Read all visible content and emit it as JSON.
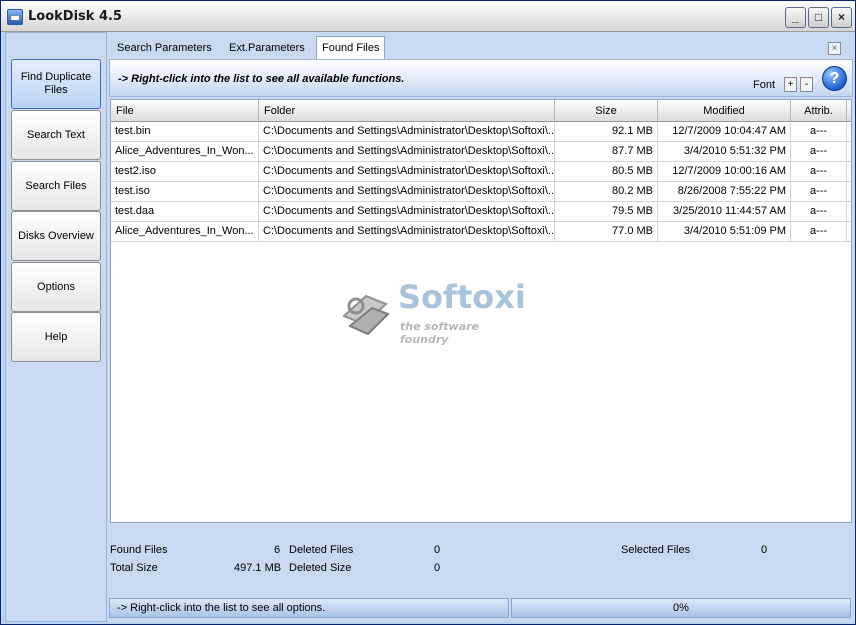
{
  "window": {
    "title": "LookDisk 4.5",
    "controls": {
      "minimize": "_",
      "maximize": "□",
      "close": "×"
    }
  },
  "sidebar": {
    "items": [
      {
        "label": "Find Duplicate Files",
        "active": true
      },
      {
        "label": "Search Text",
        "active": false
      },
      {
        "label": "Search Files",
        "active": false
      },
      {
        "label": "Disks Overview",
        "active": false
      },
      {
        "label": "Options",
        "active": false
      },
      {
        "label": "Help",
        "active": false
      }
    ]
  },
  "tabs": [
    {
      "label": "Search Parameters",
      "active": false
    },
    {
      "label": "Ext.Parameters",
      "active": false
    },
    {
      "label": "Found Files",
      "active": true
    }
  ],
  "tab_close": "×",
  "infobar": {
    "hint": "-> Right-click into the list to see all available functions.",
    "font_label": "Font",
    "font_plus": "+",
    "font_minus": "-",
    "help_glyph": "?"
  },
  "table": {
    "columns": [
      "File",
      "Folder",
      "Size",
      "Modified",
      "Attrib."
    ],
    "rows": [
      [
        "test.bin",
        "C:\\Documents and Settings\\Administrator\\Desktop\\Softoxi\\...",
        "92.1 MB",
        "12/7/2009 10:04:47 AM",
        "a---"
      ],
      [
        "Alice_Adventures_In_Won...",
        "C:\\Documents and Settings\\Administrator\\Desktop\\Softoxi\\...",
        "87.7 MB",
        "3/4/2010 5:51:32 PM",
        "a---"
      ],
      [
        "test2.iso",
        "C:\\Documents and Settings\\Administrator\\Desktop\\Softoxi\\...",
        "80.5 MB",
        "12/7/2009 10:00:16 AM",
        "a---"
      ],
      [
        "test.iso",
        "C:\\Documents and Settings\\Administrator\\Desktop\\Softoxi\\...",
        "80.2 MB",
        "8/26/2008 7:55:22 PM",
        "a---"
      ],
      [
        "test.daa",
        "C:\\Documents and Settings\\Administrator\\Desktop\\Softoxi\\...",
        "79.5 MB",
        "3/25/2010 11:44:57 AM",
        "a---"
      ],
      [
        "Alice_Adventures_In_Won...",
        "C:\\Documents and Settings\\Administrator\\Desktop\\Softoxi\\...",
        "77.0 MB",
        "3/4/2010 5:51:09 PM",
        "a---"
      ]
    ]
  },
  "watermark": {
    "brand": "Softoxi",
    "tagline": "the software foundry"
  },
  "stats": {
    "found_files_label": "Found Files",
    "found_files_value": "6",
    "total_size_label": "Total Size",
    "total_size_value": "497.1 MB",
    "deleted_files_label": "Deleted Files",
    "deleted_files_value": "0",
    "deleted_size_label": "Deleted Size",
    "deleted_size_value": "0",
    "selected_files_label": "Selected Files",
    "selected_files_value": "0"
  },
  "statusbar": {
    "message": "-> Right-click into the list to see all options.",
    "progress": "0%"
  },
  "colors": {
    "accent": "#3e6cb5",
    "panel": "#c8d9f1",
    "watermark_text": "#a9c3db"
  }
}
